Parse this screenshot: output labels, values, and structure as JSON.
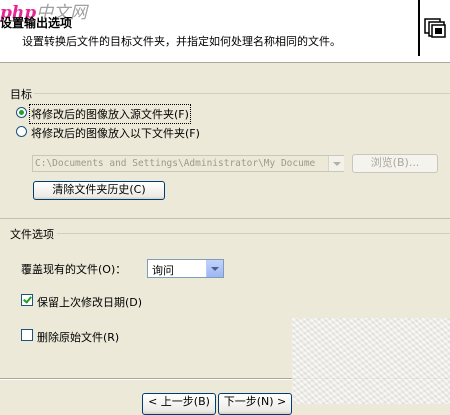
{
  "watermark": {
    "prefix": "php",
    "suffix": "中文网"
  },
  "header": {
    "title": "设置输出选项",
    "subtitle": "设置转换后文件的目标文件夹，并指定如何处理名称相同的文件。"
  },
  "target_group": {
    "label": "目标",
    "options": [
      {
        "label": "将修改后的图像放入源文件夹(F)",
        "selected": true
      },
      {
        "label": "将修改后的图像放入以下文件夹(F)",
        "selected": false
      }
    ],
    "path_value": "C:\\Documents and Settings\\Administrator\\My Docume",
    "browse_label": "浏览(B)...",
    "clear_history_label": "清除文件夹历史(C)"
  },
  "file_group": {
    "label": "文件选项",
    "overwrite_label": "覆盖现有的文件(O)：",
    "overwrite_value": "询问",
    "keep_date": {
      "label": "保留上次修改日期(D)",
      "checked": true
    },
    "delete_original": {
      "label": "删除原始文件(R)",
      "checked": false
    }
  },
  "footer": {
    "back_label": "< 上一步(B)",
    "next_label": "下一步(N) >"
  }
}
